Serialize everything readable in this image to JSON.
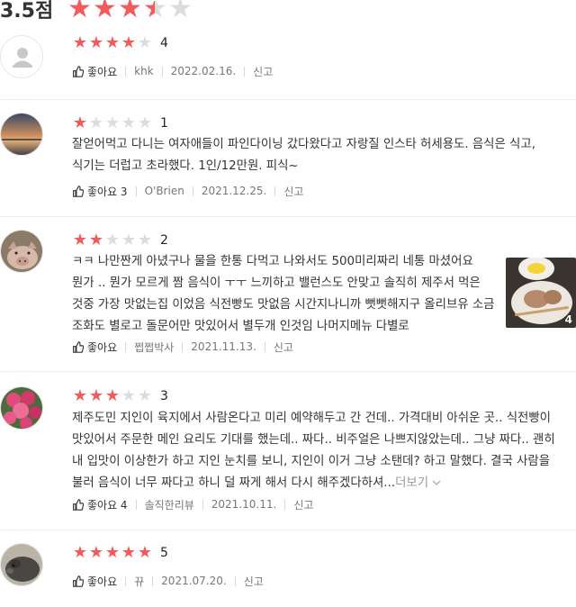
{
  "header": {
    "score": "3.5점"
  },
  "reviews": [
    {
      "rating": 4,
      "score": "4",
      "text": "",
      "likes": "좋아요",
      "author": "khk",
      "date": "2022.02.16.",
      "report": "신고",
      "avatar": "default-avatar"
    },
    {
      "rating": 1,
      "score": "1",
      "text": "잘얻어먹고 다니는 여자애들이 파인다이닝 갔다왔다고 자랑질 인스타 허세용도.  음식은 식고, 식기는 더럽고 초라했다. 1인/12만원. 피식~",
      "likes": "좋아요 3",
      "author": "O'Brien",
      "date": "2021.12.25.",
      "report": "신고",
      "avatar": "sunset-photo"
    },
    {
      "rating": 2,
      "score": "2",
      "text": "ㅋㅋ 나만짠게 아녔구나 물을 한통 다먹고 나와서도 500미리짜리 네통 마셨어요 뭔가 .. 뭔가 모르게 짬 음식이 ㅜㅜ 느끼하고 밸런스도 안맞고 솔직히 제주서 먹은 것중 가장 맛없는집 이었음 식전빵도 맛없음 시간지나니까 뻣뻣해지구 올리브유 소금 조화도 별로고 돌문어만 맛있어서 별두개 인것임 나머지메뉴 다별로",
      "likes": "좋아요",
      "author": "쩝쩝박사",
      "date": "2021.11.13.",
      "report": "신고",
      "avatar": "pig-photo",
      "photo_count": "4"
    },
    {
      "rating": 3,
      "score": "3",
      "text": "제주도민 지인이 육지에서 사람온다고 미리 예약해두고 간 건데.. 가격대비 아쉬운 곳.. 식전빵이 맛있어서 주문한 메인 요리도 기대를 했는데.. 짜다.. 비주얼은 나쁘지않았는데.. 그냥 짜다.. 괜히 내 입맛이 이상한가 하고 지인 눈치를 보니, 지인이 이거 그냥 소탠데? 하고 말했다. 결국 사람을 불러 음식이 너무 짜다고 하니 덜 짜게 해서 다시 해주겠다하셔...",
      "more": "더보기",
      "likes": "좋아요 4",
      "author": "솔직한리뷰",
      "date": "2021.10.11.",
      "report": "신고",
      "avatar": "flowers-photo"
    },
    {
      "rating": 5,
      "score": "5",
      "text": "",
      "likes": "좋아요",
      "author": "뀨",
      "date": "2021.07.20.",
      "report": "신고",
      "avatar": "animal-photo"
    }
  ],
  "colors": {
    "star_on": "#f25b5b",
    "star_off": "#dcdcdc"
  }
}
